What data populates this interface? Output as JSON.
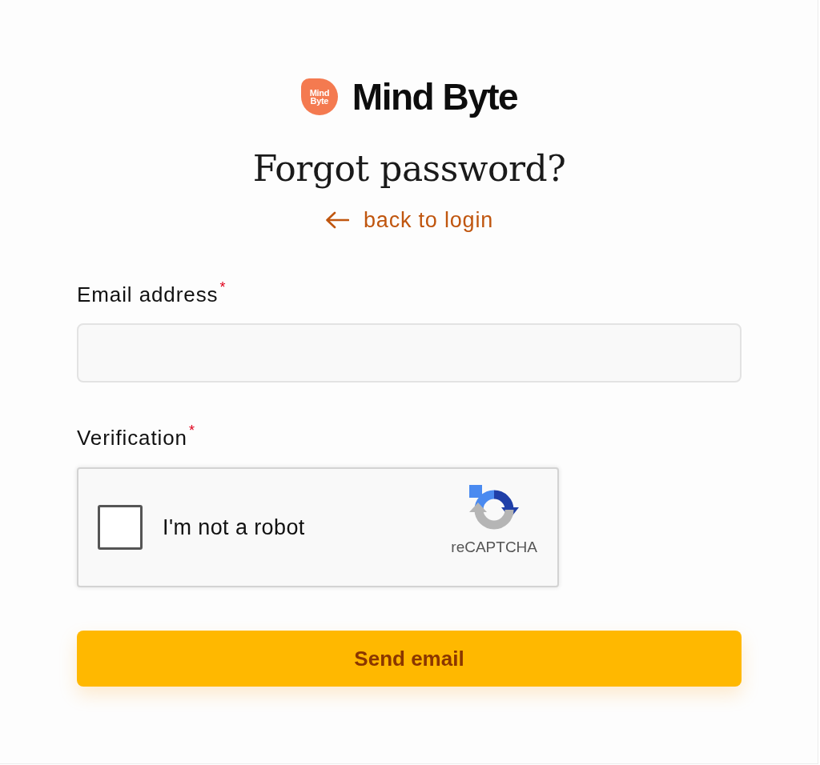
{
  "brand": {
    "logo_lines": [
      "Mind",
      "Byte"
    ],
    "name": "Mind Byte"
  },
  "title": "Forgot password?",
  "back_link": {
    "label": "back to login"
  },
  "fields": [
    {
      "kind": "text",
      "label": "Email address",
      "required_mark": "*"
    },
    {
      "kind": "captcha",
      "label": "Verification",
      "required_mark": "*",
      "checkbox": {
        "label": "I'm not a robot",
        "checked": false
      },
      "badge": "reCAPTCHA"
    }
  ],
  "submit": {
    "label": "Send email"
  }
}
